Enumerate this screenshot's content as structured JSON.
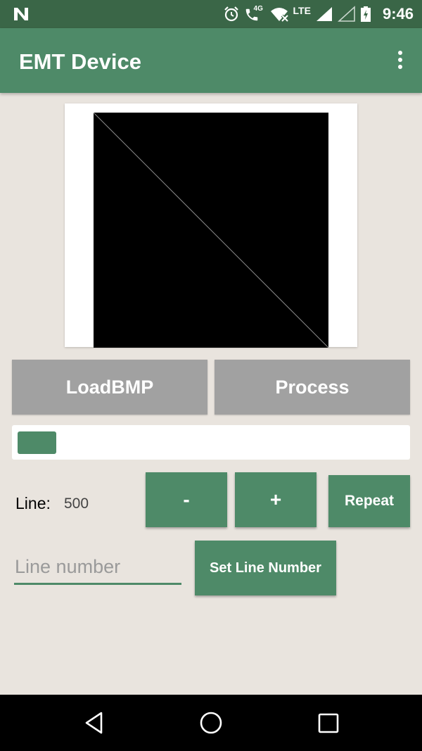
{
  "status_bar": {
    "time": "9:46",
    "network_label": "4G",
    "lte_label": "LTE",
    "icons": [
      "n-logo-icon",
      "alarm-icon",
      "call-icon",
      "wifi-off-icon",
      "signal-icon",
      "signal-empty-icon",
      "battery-charging-icon"
    ]
  },
  "app_bar": {
    "title": "EMT Device"
  },
  "buttons": {
    "load_bmp": "LoadBMP",
    "process": "Process",
    "minus": "-",
    "plus": "+",
    "repeat": "Repeat",
    "set_line_number": "Set Line Number"
  },
  "progress": {
    "value_fraction": 0.1
  },
  "line": {
    "label": "Line:",
    "value": "500"
  },
  "line_input": {
    "placeholder": "Line number",
    "value": ""
  },
  "colors": {
    "status_bar": "#3a6647",
    "app_bar": "#4e8a68",
    "accent": "#4e8a68",
    "gray_button": "#a1a1a1",
    "background": "#e9e4de"
  }
}
